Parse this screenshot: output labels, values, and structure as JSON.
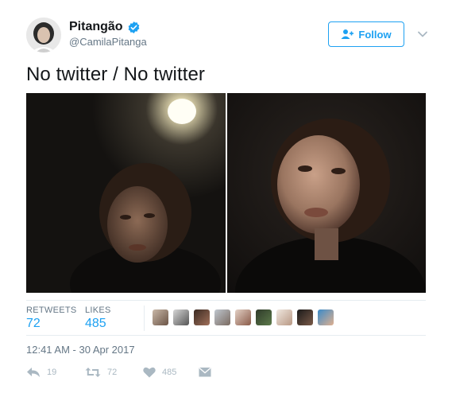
{
  "user": {
    "display_name": "Pitangão",
    "handle": "@CamilaPitanga",
    "verified": true
  },
  "follow_button": {
    "label": "Follow",
    "icon": "add-user-icon"
  },
  "menu_icon": "chevron-down-icon",
  "tweet": {
    "text": "No twitter / No twitter"
  },
  "media": [
    {
      "alt": "photo-1"
    },
    {
      "alt": "photo-2"
    }
  ],
  "stats": {
    "retweets_label": "RETWEETS",
    "retweets": "72",
    "likes_label": "LIKES",
    "likes": "485"
  },
  "liked_by_count_shown": 9,
  "timestamp": "12:41 AM - 30 Apr 2017",
  "actions": {
    "reply_count": "19",
    "retweet_count": "72",
    "like_count": "485"
  },
  "colors": {
    "accent": "#1da1f2",
    "secondary_text": "#657786",
    "action_gray": "#aab8c2",
    "divider": "#e6ecf0"
  }
}
